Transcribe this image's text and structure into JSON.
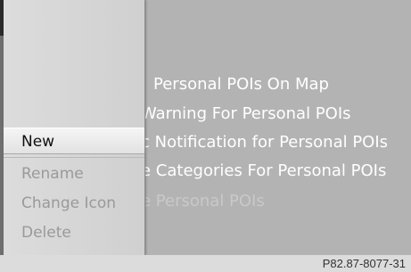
{
  "main_menu": {
    "items": [
      {
        "label": "Personal POIs On Map"
      },
      {
        "label": "Warning For Personal POIs"
      },
      {
        "label": "c Notification for Personal POIs"
      },
      {
        "label": "e Categories For Personal POIs"
      },
      {
        "label": "e Personal POIs"
      }
    ]
  },
  "submenu": {
    "items": [
      {
        "label": "New",
        "state": "selected"
      },
      {
        "label": "Rename",
        "state": "disabled"
      },
      {
        "label": "Change Icon",
        "state": "disabled"
      },
      {
        "label": "Delete",
        "state": "disabled"
      }
    ]
  },
  "figure_code": "P82.87-8077-31"
}
